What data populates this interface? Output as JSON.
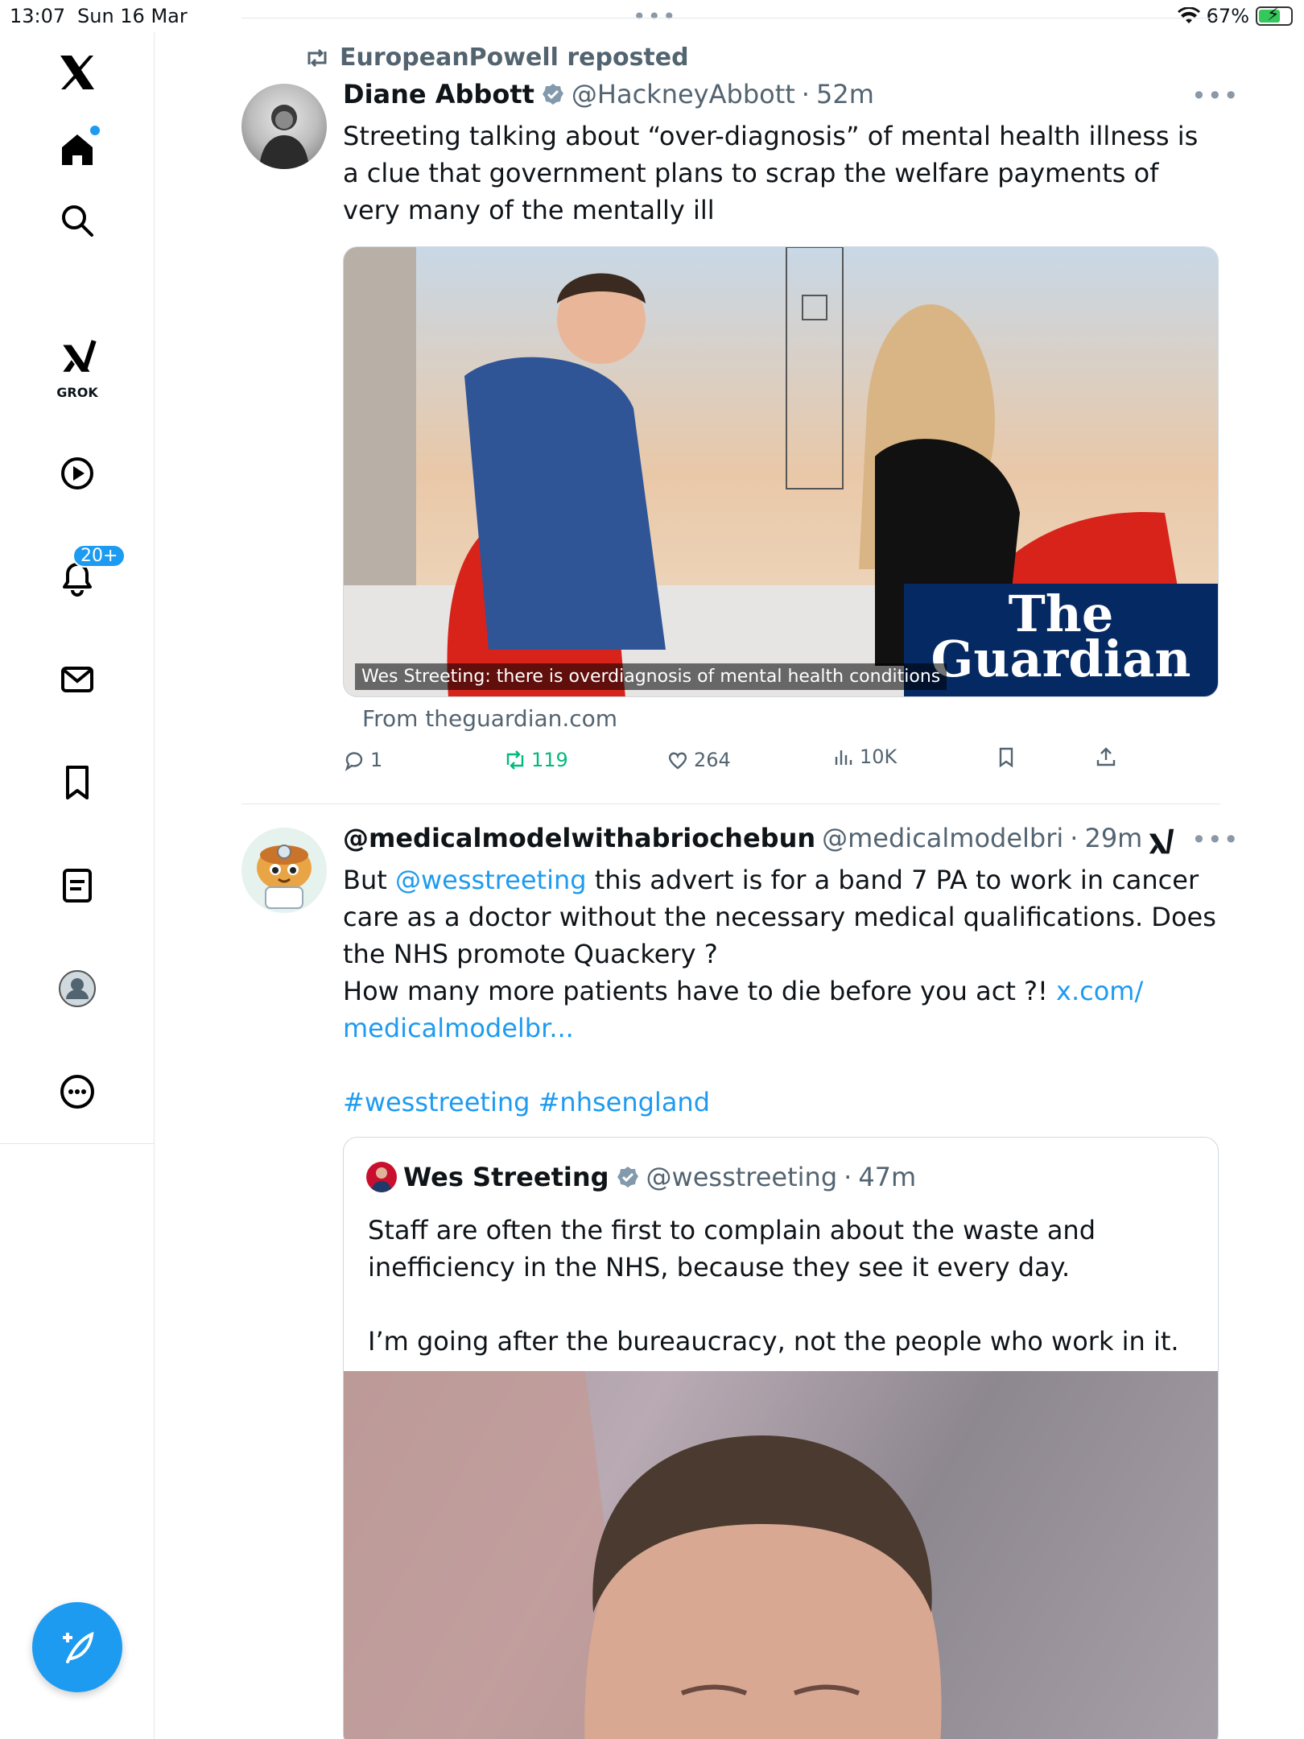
{
  "status_bar": {
    "time": "13:07",
    "date": "Sun 16 Mar",
    "battery": "67%"
  },
  "sidebar": {
    "grok_label": "GROK",
    "notifications_badge": "20+"
  },
  "post1": {
    "repost_by": "EuropeanPowell reposted",
    "author_name": "Diane Abbott",
    "author_handle": "@HackneyAbbott",
    "time": "52m",
    "text": "Streeting talking about “over-diagnosis” of mental health illness is a clue that government plans to scrap the welfare payments of very many of the mentally ill",
    "card_caption": "Wes Streeting: there is overdiagnosis of mental health conditions",
    "card_logo_line1": "The",
    "card_logo_line2": "Guardian",
    "card_source": "From theguardian.com",
    "replies": "1",
    "reposts": "119",
    "likes": "264",
    "views": "10K"
  },
  "post2": {
    "author_name": "@medicalmodelwithabriochebun",
    "author_handle": "@medicalmodelbri",
    "time": "29m",
    "text_prefix": "But ",
    "mention": "@wesstreeting",
    "text_main": " this advert is for a band 7 PA to work in cancer care as a doctor without the necessary medical qualifications. Does the NHS promote Quackery ?",
    "text_line2": "How many more patients have to die before you act ?! ",
    "link_line1": "x.com/",
    "link_line2": "medicalmodelbr...",
    "hashtags": "#wesstreeting #nhsengland"
  },
  "quote": {
    "author_name": "Wes Streeting",
    "author_handle": "@wesstreeting",
    "time": "47m",
    "text_para1": "Staff are often the first to complain about the waste and inefficiency in the NHS, because they see it every day.",
    "text_para2": "I’m going after the bureaucracy, not the people who work in it."
  },
  "colors": {
    "accent": "#1d9bf0",
    "repost_green": "#00ba7c",
    "muted": "#536471",
    "guardian_blue": "#052962"
  }
}
